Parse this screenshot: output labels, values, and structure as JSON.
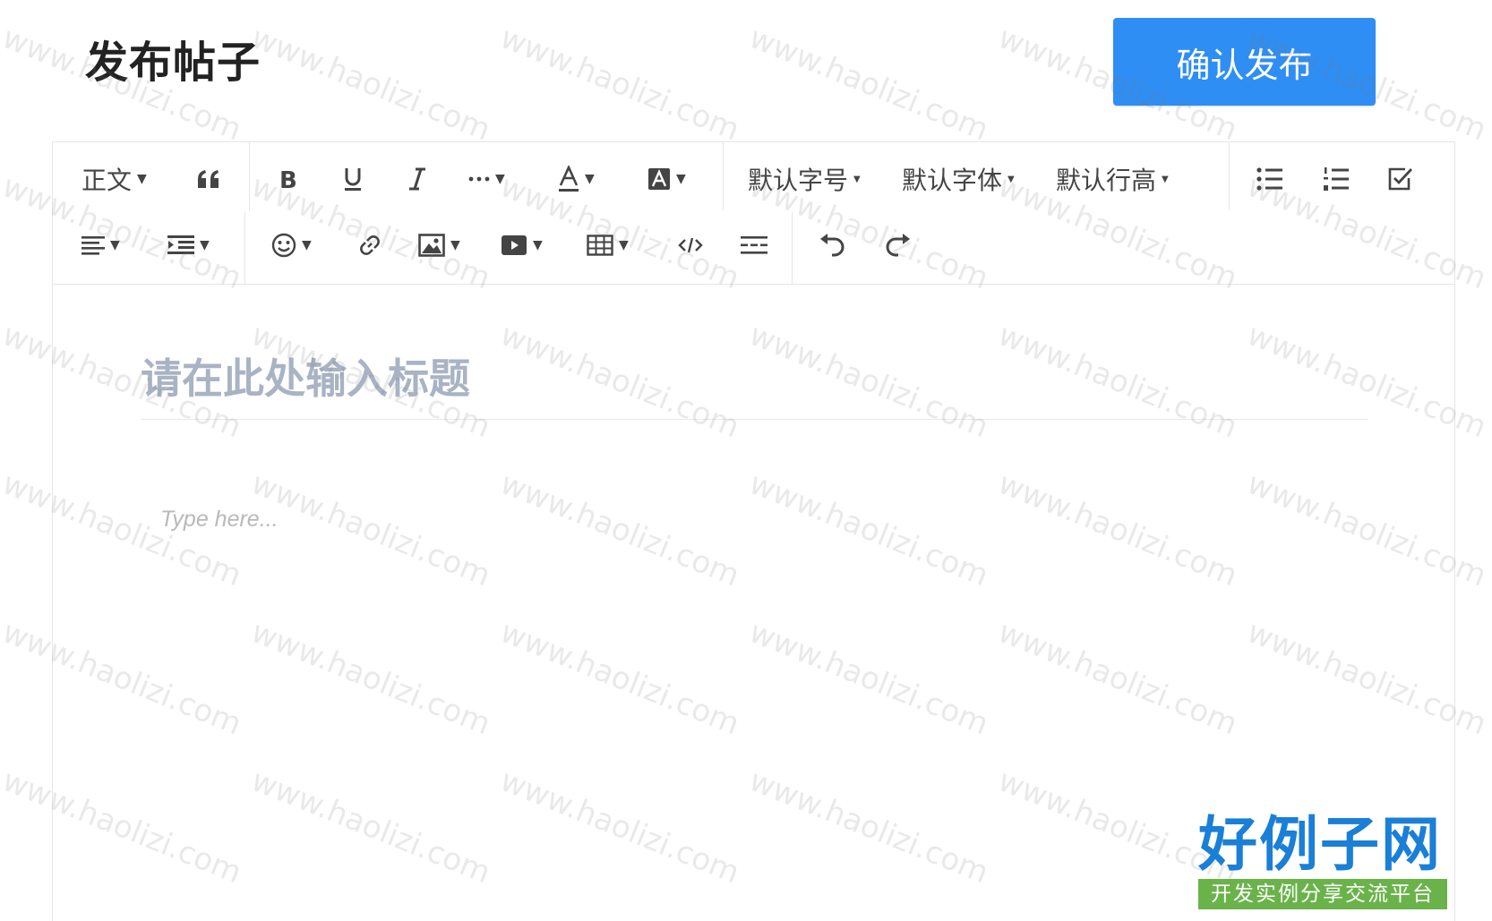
{
  "header": {
    "title": "发布帖子",
    "publish_label": "确认发布"
  },
  "toolbar": {
    "paragraph_label": "正文",
    "font_size_label": "默认字号",
    "font_family_label": "默认字体",
    "line_height_label": "默认行高"
  },
  "editor": {
    "title_placeholder": "请在此处输入标题",
    "body_placeholder": "Type here..."
  },
  "watermark": {
    "text": "www.haolizi.com",
    "logo_main": "好例子网",
    "logo_sub": "开发实例分享交流平台"
  },
  "colors": {
    "accent": "#2f8ef3",
    "logo_blue": "#1a7fd6",
    "logo_green": "#6ab34a",
    "title_placeholder": "#a8b3c4"
  },
  "icons": [
    "quote-icon",
    "bold-icon",
    "underline-icon",
    "italic-icon",
    "more-format-icon",
    "font-color-icon",
    "background-color-icon",
    "bullet-list-icon",
    "numbered-list-icon",
    "todo-checkbox-icon",
    "align-icon",
    "indent-icon",
    "emoji-icon",
    "link-icon",
    "image-icon",
    "video-icon",
    "table-icon",
    "code-icon",
    "divider-icon",
    "undo-icon",
    "redo-icon"
  ]
}
